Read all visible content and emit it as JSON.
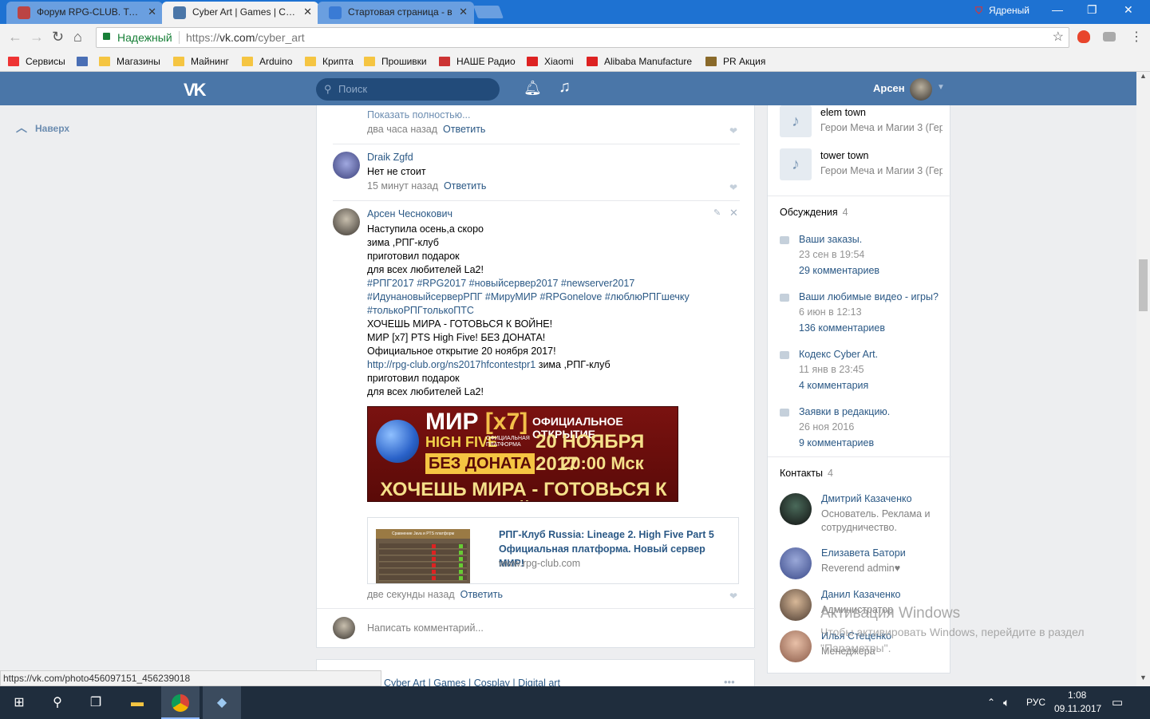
{
  "browser": {
    "tabs": [
      {
        "label": "Форум RPG-CLUB. Тема",
        "favicon_color": "#c33"
      },
      {
        "label": "Cyber Art | Games | Cosp",
        "favicon_color": "#4a76a8"
      },
      {
        "label": "Стартовая страница - в",
        "favicon_color": "#3a7bd5"
      }
    ],
    "profile_name": "Ядреный",
    "window_controls": {
      "minimize": "—",
      "restore": "❐",
      "close": "✕"
    },
    "secure_label": "Надежный",
    "url_scheme": "https://",
    "url_host": "vk.com",
    "url_path": "/cyber_art",
    "bookmarks": [
      {
        "label": "Сервисы",
        "icon": "apps-icon",
        "color": "#e33"
      },
      {
        "label": "",
        "icon": "grid-icon",
        "color": "#4a6fb5"
      },
      {
        "label": "Магазины",
        "icon": "folder-icon",
        "color": "#f5c542"
      },
      {
        "label": "Майнинг",
        "icon": "folder-icon",
        "color": "#f5c542"
      },
      {
        "label": "Arduino",
        "icon": "folder-icon",
        "color": "#f5c542"
      },
      {
        "label": "Крипта",
        "icon": "folder-icon",
        "color": "#f5c542"
      },
      {
        "label": "Прошивки",
        "icon": "folder-icon",
        "color": "#f5c542"
      },
      {
        "label": "НАШЕ Радио",
        "icon": "radio-icon",
        "color": "#c33"
      },
      {
        "label": "Xiaomi",
        "icon": "xiaomi-icon",
        "color": "#d22"
      },
      {
        "label": "Alibaba Manufacture",
        "icon": "alibaba-icon",
        "color": "#d22"
      },
      {
        "label": "PR Акция",
        "icon": "pr-icon",
        "color": "#8a6a2a"
      }
    ],
    "status_url": "https://vk.com/photo456097151_456239018"
  },
  "vk": {
    "logo": "VK",
    "search_placeholder": "Поиск",
    "user_name": "Арсен",
    "up_label": "Наверх"
  },
  "wall": {
    "prev_comment": {
      "show_more": "Показать полностью...",
      "time": "два часа назад",
      "reply": "Ответить"
    },
    "comment1": {
      "author": "Draik Zgfd",
      "text": "Нет не стоит",
      "time": "15 минут назад",
      "reply": "Ответить"
    },
    "comment2": {
      "author": "Арсен Чеснокович",
      "lines": [
        "Наступила осень,а скоро",
        "зима ,РПГ-клуб",
        "приготовил подарок",
        "для всех любителей La2!"
      ],
      "hashtags": [
        "#РПГ2017 #RPG2017 #новыйсервер2017 #newserver2017",
        "#ИдунановыйсерверРПГ #МируМИР #RPGonelove #люблюРПГшечку",
        "#толькоРПГтолькоПТС"
      ],
      "lines2": [
        "ХОЧЕШЬ МИРА - ГОТОВЬСЯ К ВОЙНЕ!",
        "МИР [x7] PTS High Five! БЕЗ ДОНАТА!",
        "Официальное открытие 20 ноября 2017!"
      ],
      "link": "http://rpg-club.org/ns2017hfcontestpr1",
      "link_tail": " зима ,РПГ-клуб",
      "lines3": [
        "приготовил подарок",
        "для всех любителей La2!"
      ],
      "time": "две секунды назад",
      "reply": "Ответить"
    },
    "banner": {
      "mir": "МИР",
      "x7": "[x7]",
      "high_five": "HIGH FIVE",
      "platform": "ОФИЦИАЛЬНАЯ ПЛАТФОРМА",
      "no_donate": "БЕЗ ДОНАТА",
      "official": "ОФИЦИАЛЬНОЕ ОТКРЫТИЕ",
      "date": "20 НОЯБРЯ 2017",
      "time": "20:00 Мск",
      "bottom": "ХОЧЕШЬ МИРА - ГОТОВЬСЯ К ВОЙНЕ"
    },
    "snippet": {
      "title": "РПГ-Клуб Russia: Lineage 2. High Five Part 5 Официальная платформа. Новый сервер МИР!",
      "domain": "www.rpg-club.com",
      "thumb_title": "Сравнение Java и PTS платформ"
    },
    "comment_placeholder": "Написать комментарий...",
    "next_post_author": "Cyber Art | Games | Cosplay | Digital art"
  },
  "right": {
    "audios": [
      {
        "title": "elem town",
        "artist": "Герои Меча и Магии 3 (Гер"
      },
      {
        "title": "tower town",
        "artist": "Герои Меча и Магии 3 (Гер"
      }
    ],
    "discussions_label": "Обсуждения",
    "discussions_count": "4",
    "discussions": [
      {
        "title": "Ваши заказы.",
        "date": "23 сен в 19:54",
        "comments": "29 комментариев"
      },
      {
        "title": "Ваши любимые видео - игры?",
        "date": "6 июн в 12:13",
        "comments": "136 комментариев"
      },
      {
        "title": "Кодекс Cyber Art.",
        "date": "11 янв в 23:45",
        "comments": "4 комментария"
      },
      {
        "title": "Заявки в редакцию.",
        "date": "26 ноя 2016",
        "comments": "9 комментариев"
      }
    ],
    "contacts_label": "Контакты",
    "contacts_count": "4",
    "contacts": [
      {
        "name": "Дмитрий Казаченко",
        "role": "Основатель. Реклама и сотрудничество."
      },
      {
        "name": "Елизавета Батори",
        "role": "Reverend admin♥"
      },
      {
        "name": "Данил Казаченко",
        "role": "Администратор"
      },
      {
        "name": "Илья Стеценко",
        "role": "Менеджера"
      }
    ]
  },
  "watermark": {
    "title": "Активация Windows",
    "text": "Чтобы активировать Windows, перейдите в раздел",
    "text2": "\"Параметры\"."
  },
  "taskbar": {
    "lang": "РУС",
    "time": "1:08",
    "date": "09.11.2017"
  }
}
